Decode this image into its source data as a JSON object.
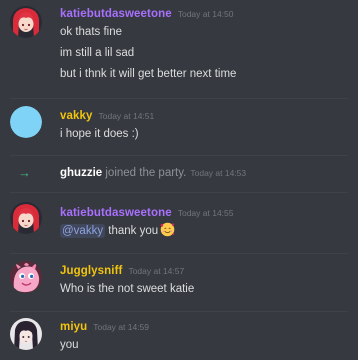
{
  "colors": {
    "background": "#36393f",
    "text": "#dcddde",
    "timestamp": "#72767d",
    "join_arrow": "#43b581",
    "mention_text": "#8ea1e1"
  },
  "messages": [
    {
      "username": "katiebutdasweetone",
      "username_color": "#a970ff",
      "timestamp": "Today at 14:50",
      "avatar": "red-haired-anime-girl-avatar",
      "lines": [
        "ok thats fine",
        "im still a lil sad",
        "but i thnk it will get better next time"
      ]
    },
    {
      "username": "vakky",
      "username_color": "#f1c40f",
      "timestamp": "Today at 14:51",
      "avatar": "light-blue-circle-avatar",
      "lines": [
        "i hope it does :)"
      ]
    },
    {
      "username": "katiebutdasweetone",
      "username_color": "#a970ff",
      "timestamp": "Today at 14:55",
      "avatar": "red-haired-anime-girl-avatar",
      "mention": "@vakky",
      "text": " thank you",
      "emoji": "smiling-face-with-hearts-emoji"
    },
    {
      "username": "Jugglysniff",
      "username_color": "#f1c40f",
      "timestamp": "Today at 14:57",
      "avatar": "pink-creature-avatar",
      "lines": [
        "Who is the not sweet katie"
      ]
    },
    {
      "username": "miyu",
      "username_color": "#f1c40f",
      "timestamp": "Today at 14:59",
      "avatar": "dark-haired-anime-girl-avatar",
      "lines": [
        "you"
      ]
    }
  ],
  "join": {
    "icon": "join-arrow-icon",
    "arrow": "→",
    "username": "ghuzzie",
    "text": " joined the party.",
    "timestamp": "Today at 14:53"
  }
}
